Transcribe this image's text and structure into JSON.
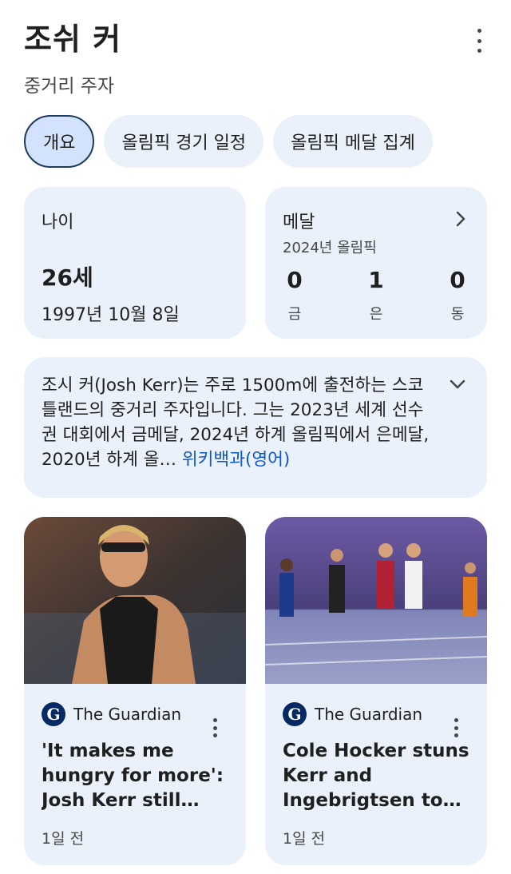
{
  "header": {
    "title": "조쉬 커",
    "subtitle": "중거리 주자"
  },
  "tabs": [
    {
      "label": "개요",
      "active": true
    },
    {
      "label": "올림픽 경기 일정",
      "active": false
    },
    {
      "label": "올림픽 메달 집계",
      "active": false
    }
  ],
  "age": {
    "label": "나이",
    "value": "26세",
    "birthdate": "1997년 10월 8일"
  },
  "medals": {
    "label": "메달",
    "event": "2024년 올림픽",
    "items": [
      {
        "count": "0",
        "type": "금"
      },
      {
        "count": "1",
        "type": "은"
      },
      {
        "count": "0",
        "type": "동"
      }
    ]
  },
  "description": {
    "text": "조시 커(Josh Kerr)는 주로 1500m에 출전하는 스코틀랜드의 중거리 주자입니다. 그는 2023년 세계 선수권 대회에서 금메달, 2024년 하계 올림픽에서 은메달, 2020년 하계 올",
    "ellipsis": "… ",
    "source": "위키백과(영어)"
  },
  "news": [
    {
      "source": "The Guardian",
      "logo_letter": "G",
      "title": "'It makes me hungry for more': Josh Kerr still proud after…",
      "time": "1일 전"
    },
    {
      "source": "The Guardian",
      "logo_letter": "G",
      "title": "Cole Hocker stuns Kerr and Ingebrigtsen to wi…",
      "time": "1일 전"
    }
  ],
  "icons": {
    "more": "more-vert-icon",
    "chevron_right": "chevron-right-icon",
    "chevron_down": "chevron-down-icon",
    "source_logo": "guardian-logo-icon"
  },
  "colors": {
    "card_bg": "#eaf1fb",
    "active_tab_bg": "#d3e3fd",
    "link": "#0b57d0",
    "guardian": "#052962"
  }
}
